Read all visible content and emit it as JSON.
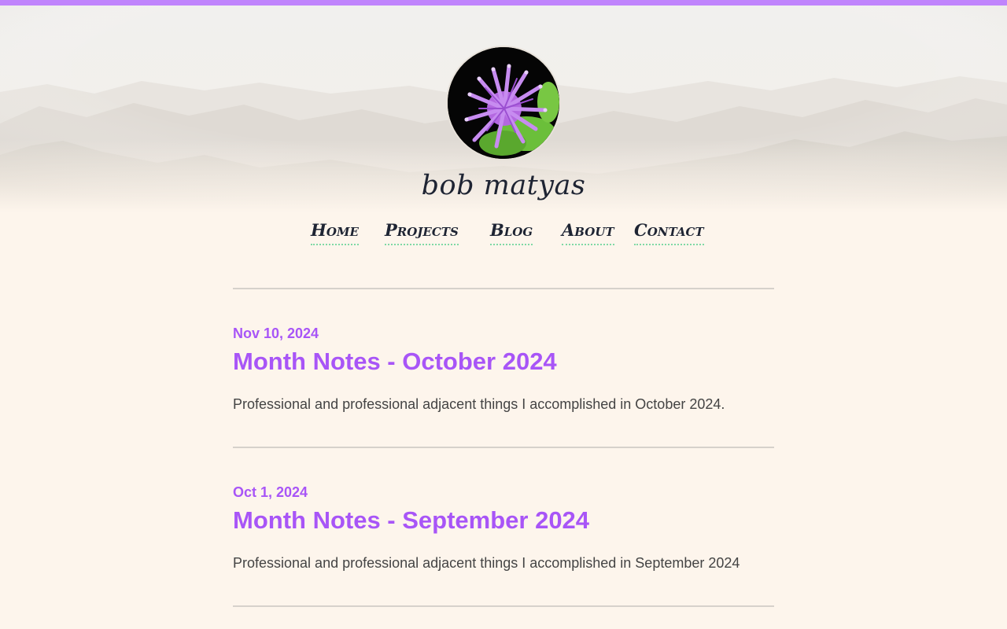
{
  "site": {
    "title": "bob matyas",
    "avatar_alt": "flower-avatar"
  },
  "nav": {
    "items": [
      {
        "label": "Home"
      },
      {
        "label": "Projects"
      },
      {
        "label": "Blog"
      },
      {
        "label": "About"
      },
      {
        "label": "Contact"
      }
    ]
  },
  "posts": [
    {
      "date": "Nov 10, 2024",
      "title": "Month Notes - October 2024",
      "summary": "Professional and professional adjacent things I accomplished in October 2024."
    },
    {
      "date": "Oct 1, 2024",
      "title": "Month Notes - September 2024",
      "summary": "Professional and professional adjacent things I accomplished in September 2024"
    }
  ],
  "colors": {
    "accent": "#a855f7",
    "top_bar": "#c084fc",
    "background": "#fdf5ec",
    "nav_underline": "#7fd9a5",
    "text_dark": "#1e2433"
  }
}
